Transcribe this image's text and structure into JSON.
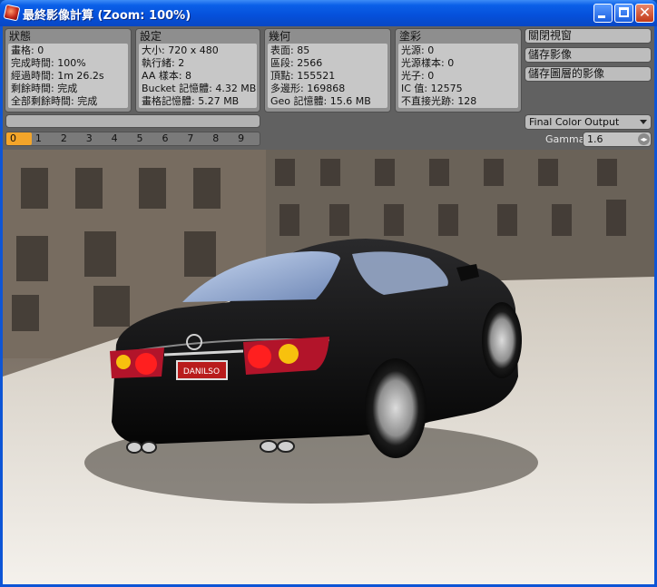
{
  "window": {
    "title": "最終影像計算 (Zoom: 100%)",
    "colors": {
      "titlebar": "#0550da",
      "client": "#616161",
      "active_tab": "#f3a52a"
    }
  },
  "panels": {
    "status": {
      "title": "狀態",
      "lines": [
        "畫格: 0",
        "完成時間: 100%",
        "經過時間: 1m 26.2s",
        "剩餘時間: 完成",
        "全部剩餘時間: 完成"
      ]
    },
    "settings": {
      "title": "設定",
      "lines": [
        "大小: 720 x 480",
        "執行緒: 2",
        "AA 樣本: 8",
        "Bucket 記憶體: 4.32 MB",
        "畫格記憶體: 5.27 MB"
      ]
    },
    "geometry": {
      "title": "幾何",
      "lines": [
        "表面: 85",
        "區段: 2566",
        "頂點: 155521",
        "多邊形: 169868",
        "Geo 記憶體: 15.6 MB"
      ]
    },
    "shading": {
      "title": "塗彩",
      "lines": [
        "光源: 0",
        "光源樣本: 0",
        "光子: 0",
        "IC 值: 12575",
        "不直接光跡: 128"
      ]
    }
  },
  "actions": {
    "close_window": "關閉視窗",
    "save_image": "儲存影像",
    "save_layered": "儲存圖層的影像"
  },
  "frame_tabs": [
    "0",
    "1",
    "2",
    "3",
    "4",
    "5",
    "6",
    "7",
    "8",
    "9"
  ],
  "active_frame_tab": 0,
  "output": {
    "selected": "Final Color Output"
  },
  "gamma": {
    "label": "Gamma",
    "value": "1.6"
  },
  "render": {
    "plate_text": "DANILSO"
  },
  "icons": {
    "app": "render-app-icon",
    "minimize": "minimize-icon",
    "maximize": "maximize-icon",
    "close": "close-icon",
    "dropdown": "chevron-down-icon",
    "spinner": "spinner-icon"
  }
}
